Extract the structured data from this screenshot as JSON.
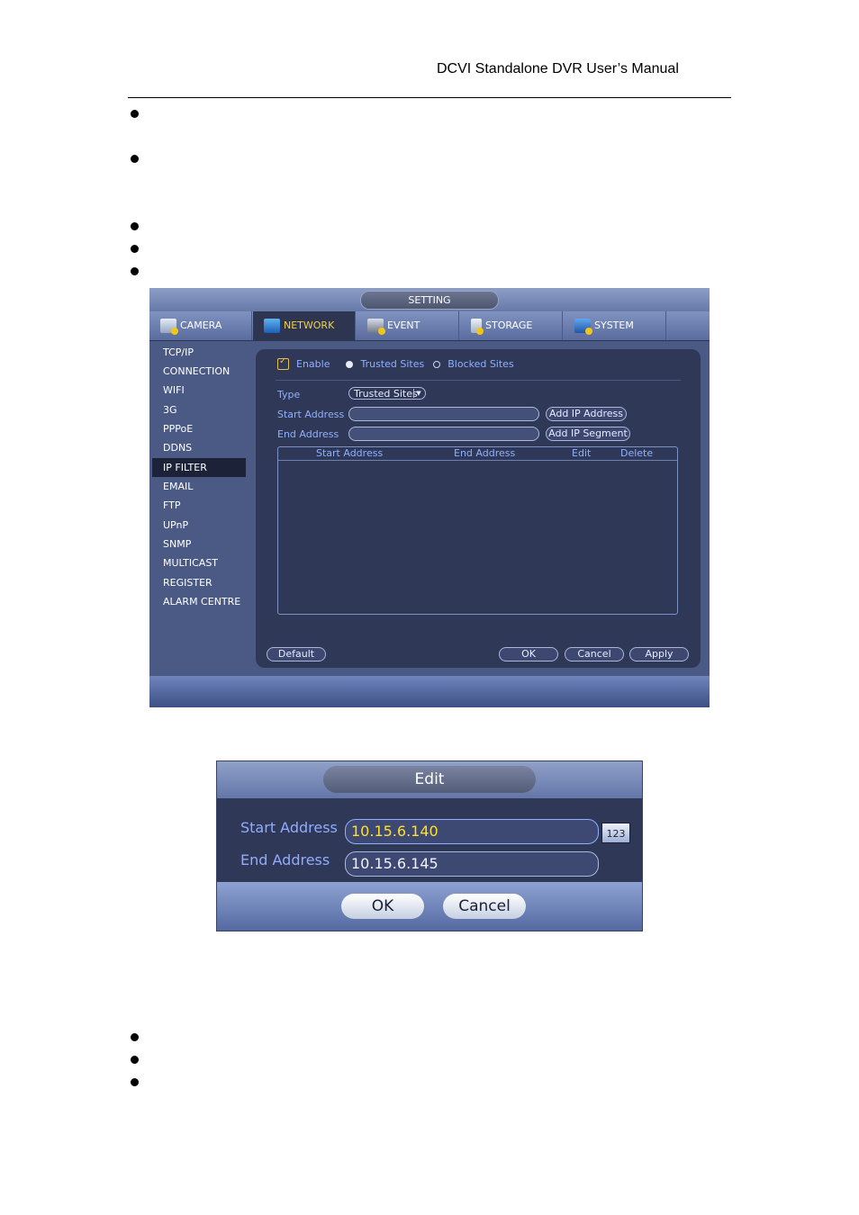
{
  "document": {
    "header_title": "DCVI Standalone DVR User’s Manual",
    "bullet_count_top": 5,
    "bullet_count_bottom": 3
  },
  "setting_window": {
    "title": "SETTING",
    "tabs": [
      {
        "label": "CAMERA",
        "icon": "camera-settings-icon",
        "active": false
      },
      {
        "label": "NETWORK",
        "icon": "network-icon",
        "active": true
      },
      {
        "label": "EVENT",
        "icon": "event-icon",
        "active": false
      },
      {
        "label": "STORAGE",
        "icon": "storage-icon",
        "active": false
      },
      {
        "label": "SYSTEM",
        "icon": "system-icon",
        "active": false
      }
    ],
    "sidebar": [
      {
        "label": "TCP/IP"
      },
      {
        "label": "CONNECTION"
      },
      {
        "label": "WIFI"
      },
      {
        "label": "3G"
      },
      {
        "label": "PPPoE"
      },
      {
        "label": "DDNS"
      },
      {
        "label": "IP FILTER",
        "active": true
      },
      {
        "label": "EMAIL"
      },
      {
        "label": "FTP"
      },
      {
        "label": "UPnP"
      },
      {
        "label": "SNMP"
      },
      {
        "label": "MULTICAST"
      },
      {
        "label": "REGISTER"
      },
      {
        "label": "ALARM CENTRE"
      }
    ],
    "form": {
      "enable_label": "Enable",
      "enable_checked": true,
      "radio_trusted": "Trusted Sites",
      "radio_blocked": "Blocked Sites",
      "radio_selected": "Trusted Sites",
      "type_label": "Type",
      "type_value": "Trusted Sites",
      "start_label": "Start Address",
      "start_value": "",
      "end_label": "End Address",
      "end_value": "",
      "add_ip_address": "Add IP Address",
      "add_ip_segment": "Add IP Segment"
    },
    "table": {
      "columns": [
        "Start Address",
        "End Address",
        "Edit",
        "Delete"
      ],
      "rows": []
    },
    "buttons": {
      "default": "Default",
      "ok": "OK",
      "cancel": "Cancel",
      "apply": "Apply"
    }
  },
  "edit_dialog": {
    "title": "Edit",
    "start_label": "Start Address",
    "start_value": "10.15.6.140",
    "end_label": "End Address",
    "end_value": "10.15.6.145",
    "keyboard_button": "123",
    "ok": "OK",
    "cancel": "Cancel"
  }
}
